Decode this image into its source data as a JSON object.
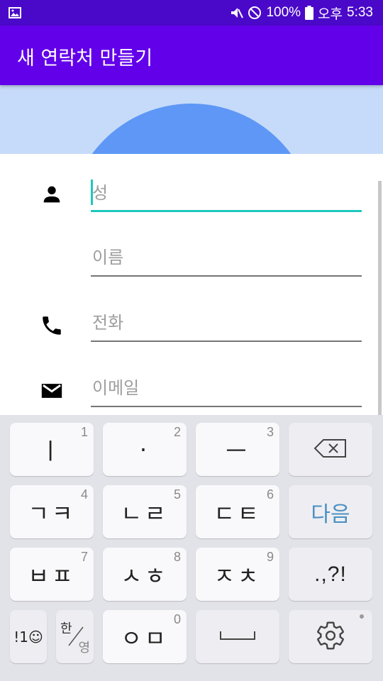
{
  "status_bar": {
    "battery_percent": "100%",
    "ampm": "오후",
    "time": "5:33",
    "icons": [
      "image-icon",
      "mute-icon",
      "do-not-disturb-icon",
      "battery-icon"
    ]
  },
  "app_bar": {
    "title": "새 연락처 만들기",
    "color": "#6200ea"
  },
  "photo": {
    "background": "#c6dbf9",
    "circle_color": "#5e97f6"
  },
  "form": {
    "accent": "#1ec8be",
    "fields": [
      {
        "placeholder": "성",
        "value": "",
        "icon": "person-icon"
      },
      {
        "placeholder": "이름",
        "value": "",
        "icon": ""
      },
      {
        "placeholder": "전화",
        "value": "",
        "icon": "phone-icon"
      },
      {
        "placeholder": "이메일",
        "value": "",
        "icon": "email-icon"
      }
    ]
  },
  "keyboard": {
    "row1": [
      {
        "label": "ㅣ",
        "hint": "1"
      },
      {
        "label": "·",
        "hint": "2"
      },
      {
        "label": "ㅡ",
        "hint": "3"
      },
      {
        "label": "",
        "icon": "backspace-icon"
      }
    ],
    "row2": [
      {
        "label": "ㄱㅋ",
        "hint": "4"
      },
      {
        "label": "ㄴㄹ",
        "hint": "5"
      },
      {
        "label": "ㄷㅌ",
        "hint": "6"
      },
      {
        "label": "다음"
      }
    ],
    "row3": [
      {
        "label": "ㅂㅍ",
        "hint": "7"
      },
      {
        "label": "ㅅㅎ",
        "hint": "8"
      },
      {
        "label": "ㅈㅊ",
        "hint": "9"
      },
      {
        "label": ".,?!"
      }
    ],
    "row4": {
      "symbols": "!1☺",
      "lang_han": "한",
      "lang_yeong": "영",
      "zero_key": {
        "label": "ㅇㅁ",
        "hint": "0"
      },
      "space_icon": "space-icon",
      "settings_icon": "settings-icon"
    },
    "next_color": "#4a90c2"
  }
}
